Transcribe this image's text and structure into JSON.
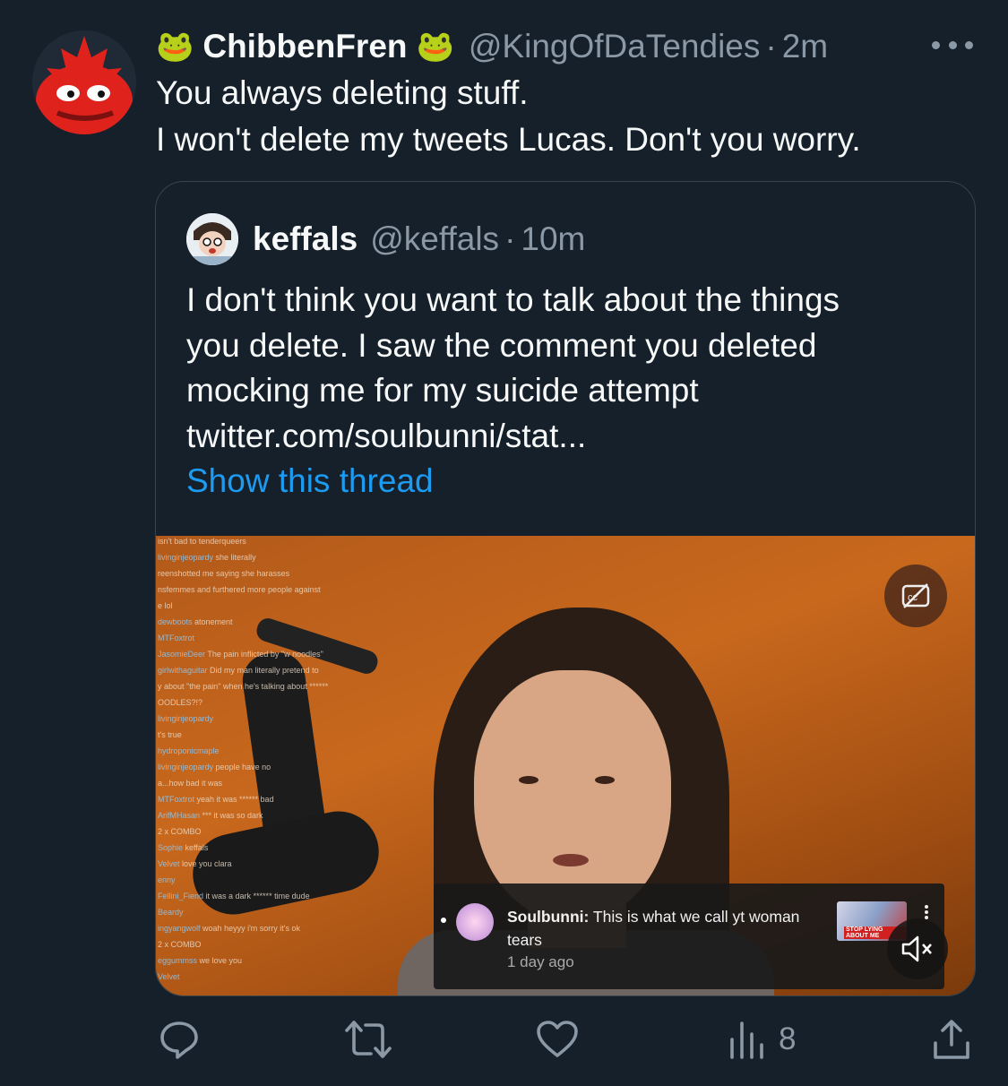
{
  "tweet": {
    "author_name": "ChibbenFren",
    "name_emoji": "🐸",
    "author_handle": "@KingOfDaTendies",
    "separator": "·",
    "time": "2m",
    "text_lines": [
      "You always deleting stuff.",
      "I won't delete my tweets Lucas. Don't you worry."
    ],
    "avatar_icon": "pepe-maple-leaf-avatar",
    "more_icon": "more-horizontal-icon"
  },
  "quoted": {
    "author_name": "keffals",
    "author_handle": "@keffals",
    "separator": "·",
    "time": "10m",
    "text_lines": [
      "I don't think you want to talk about the things",
      "you delete. I saw the comment you deleted",
      "mocking me for my suicide attempt",
      "twitter.com/soulbunni/stat..."
    ],
    "show_thread": "Show this thread",
    "media": {
      "chat_lines": [
        {
          "user": "",
          "msg": "isn't bad to tenderqueers"
        },
        {
          "user": "livinginjeopardy",
          "msg": "she literally"
        },
        {
          "user": "",
          "msg": "reenshotted me saying she harasses"
        },
        {
          "user": "",
          "msg": "nsfemmes and furthered more people against"
        },
        {
          "user": "",
          "msg": "e lol"
        },
        {
          "user": "dewboots",
          "msg": "atonement"
        },
        {
          "user": "MTFoxtrot",
          "msg": ""
        },
        {
          "user": "JasomieDeer",
          "msg": "The pain inflicted by \"w noodles\""
        },
        {
          "user": "girlwithaguitar",
          "msg": "Did my man literally pretend to"
        },
        {
          "user": "",
          "msg": "y about \"the pain\" when he's talking about ******"
        },
        {
          "user": "",
          "msg": "OODLES?!?"
        },
        {
          "user": "livinginjeopardy",
          "msg": ""
        },
        {
          "user": "",
          "msg": "t's true"
        },
        {
          "user": "hydroponicmaple",
          "msg": ""
        },
        {
          "user": "livinginjeopardy",
          "msg": "people have no"
        },
        {
          "user": "",
          "msg": "a...how bad it was"
        },
        {
          "user": "MTFoxtrot",
          "msg": "yeah it was ****** bad"
        },
        {
          "user": "ArifMHasan",
          "msg": "*** it was so dark"
        },
        {
          "user": "",
          "msg": "2 x COMBO"
        },
        {
          "user": "Sophie",
          "msg": "keffals"
        },
        {
          "user": "Velvet",
          "msg": "love you clara"
        },
        {
          "user": "enny",
          "msg": ""
        },
        {
          "user": "Fellini_Fiend",
          "msg": "it was a dark ****** time dude"
        },
        {
          "user": "Beardy",
          "msg": ""
        },
        {
          "user": "ingyangwolf",
          "msg": "woah heyyy i'm sorry it's ok"
        },
        {
          "user": "",
          "msg": "2 x COMBO"
        },
        {
          "user": "eggummss",
          "msg": "we love you"
        },
        {
          "user": "Velvet",
          "msg": ""
        }
      ],
      "yt_card": {
        "channel": "Soulbunni:",
        "message": " This is what we call yt woman tears",
        "time": "1 day ago",
        "thumb_label": "STOP LYING ABOUT ME"
      },
      "cc_icon": "captions-off-icon",
      "mute_icon": "volume-muted-icon"
    }
  },
  "actions": {
    "reply_icon": "reply-icon",
    "retweet_icon": "retweet-icon",
    "like_icon": "heart-icon",
    "views_icon": "views-chart-icon",
    "views_count": "8",
    "share_icon": "share-icon"
  },
  "colors": {
    "background": "#15202b",
    "text": "#f7f9f9",
    "secondary": "#8b98a5",
    "link": "#1d9bf0",
    "border": "#38444d"
  }
}
